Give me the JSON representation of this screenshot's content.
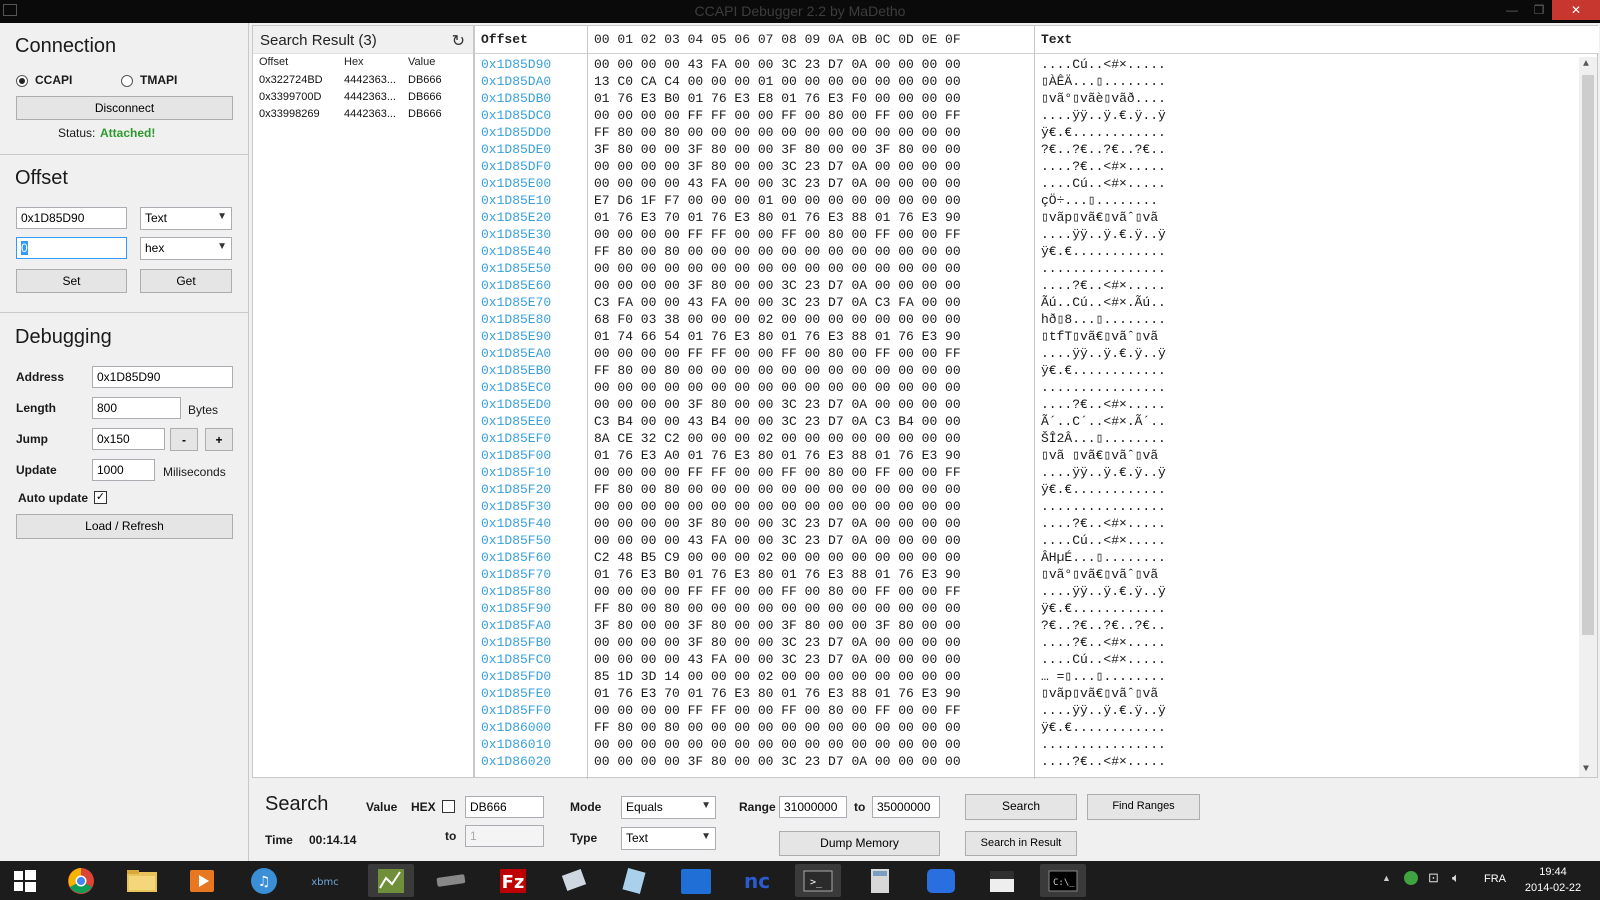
{
  "window": {
    "title": "CCAPI Debugger 2.2 by MaDetho"
  },
  "connection": {
    "title": "Connection",
    "radio_ccapi": "CCAPI",
    "radio_tmapi": "TMAPI",
    "selected": "CCAPI",
    "disconnect_label": "Disconnect",
    "status_label": "Status:",
    "status_value": "Attached!",
    "status_color": "#2e9a2e"
  },
  "offset": {
    "title": "Offset",
    "address_value": "0x1D85D90",
    "type_selected": "Text",
    "value_value": "0",
    "format_selected": "hex",
    "set_label": "Set",
    "get_label": "Get"
  },
  "debugging": {
    "title": "Debugging",
    "address_label": "Address",
    "address_value": "0x1D85D90",
    "length_label": "Length",
    "length_value": "800",
    "length_unit": "Bytes",
    "jump_label": "Jump",
    "jump_value": "0x150",
    "jump_minus": "-",
    "jump_plus": "+",
    "update_label": "Update",
    "update_value": "1000",
    "update_unit": "Miliseconds",
    "auto_update_label": "Auto update",
    "auto_update_checked": "✓",
    "load_label": "Load / Refresh"
  },
  "search_results": {
    "title": "Search Result (3)",
    "columns": [
      "Offset",
      "Hex",
      "Value"
    ],
    "rows": [
      [
        "0x322724BD",
        "4442363...",
        "DB666"
      ],
      [
        "0x3399700D",
        "4442363...",
        "DB666"
      ],
      [
        "0x33998269",
        "4442363...",
        "DB666"
      ]
    ]
  },
  "hex_view": {
    "col_offset": "Offset",
    "col_bytes": "00 01 02 03 04 05 06 07 08 09 0A 0B 0C 0D 0E 0F",
    "col_text": "Text",
    "lines": [
      [
        "0x1D85D90",
        "00 00 00 00 43 FA 00 00 3C 23 D7 0A 00 00 00 00",
        "....Cú..<#×....."
      ],
      [
        "0x1D85DA0",
        "13 C0 CA C4 00 00 00 01 00 00 00 00 00 00 00 00",
        "▯ÀÊÄ...▯........"
      ],
      [
        "0x1D85DB0",
        "01 76 E3 B0 01 76 E3 E8 01 76 E3 F0 00 00 00 00",
        "▯vã°▯vãè▯vãð...."
      ],
      [
        "0x1D85DC0",
        "00 00 00 00 FF FF 00 00 FF 00 80 00 FF 00 00 FF",
        "....ÿÿ..ÿ.€.ÿ..ÿ"
      ],
      [
        "0x1D85DD0",
        "FF 80 00 80 00 00 00 00 00 00 00 00 00 00 00 00",
        "ÿ€.€............"
      ],
      [
        "0x1D85DE0",
        "3F 80 00 00 3F 80 00 00 3F 80 00 00 3F 80 00 00",
        "?€..?€..?€..?€.."
      ],
      [
        "0x1D85DF0",
        "00 00 00 00 3F 80 00 00 3C 23 D7 0A 00 00 00 00",
        "....?€..<#×....."
      ],
      [
        "0x1D85E00",
        "00 00 00 00 43 FA 00 00 3C 23 D7 0A 00 00 00 00",
        "....Cú..<#×....."
      ],
      [
        "0x1D85E10",
        "E7 D6 1F F7 00 00 00 01 00 00 00 00 00 00 00 00",
        "çÖ÷...▯........"
      ],
      [
        "0x1D85E20",
        "01 76 E3 70 01 76 E3 80 01 76 E3 88 01 76 E3 90",
        "▯vãp▯vã€▯vãˆ▯vã"
      ],
      [
        "0x1D85E30",
        "00 00 00 00 FF FF 00 00 FF 00 80 00 FF 00 00 FF",
        "....ÿÿ..ÿ.€.ÿ..ÿ"
      ],
      [
        "0x1D85E40",
        "FF 80 00 80 00 00 00 00 00 00 00 00 00 00 00 00",
        "ÿ€.€............"
      ],
      [
        "0x1D85E50",
        "00 00 00 00 00 00 00 00 00 00 00 00 00 00 00 00",
        "................"
      ],
      [
        "0x1D85E60",
        "00 00 00 00 3F 80 00 00 3C 23 D7 0A 00 00 00 00",
        "....?€..<#×....."
      ],
      [
        "0x1D85E70",
        "C3 FA 00 00 43 FA 00 00 3C 23 D7 0A C3 FA 00 00",
        "Ãú..Cú..<#×.Ãú.."
      ],
      [
        "0x1D85E80",
        "68 F0 03 38 00 00 00 02 00 00 00 00 00 00 00 00",
        "hð▯8...▯........"
      ],
      [
        "0x1D85E90",
        "01 74 66 54 01 76 E3 80 01 76 E3 88 01 76 E3 90",
        "▯tfT▯vã€▯vãˆ▯vã"
      ],
      [
        "0x1D85EA0",
        "00 00 00 00 FF FF 00 00 FF 00 80 00 FF 00 00 FF",
        "....ÿÿ..ÿ.€.ÿ..ÿ"
      ],
      [
        "0x1D85EB0",
        "FF 80 00 80 00 00 00 00 00 00 00 00 00 00 00 00",
        "ÿ€.€............"
      ],
      [
        "0x1D85EC0",
        "00 00 00 00 00 00 00 00 00 00 00 00 00 00 00 00",
        "................"
      ],
      [
        "0x1D85ED0",
        "00 00 00 00 3F 80 00 00 3C 23 D7 0A 00 00 00 00",
        "....?€..<#×....."
      ],
      [
        "0x1D85EE0",
        "C3 B4 00 00 43 B4 00 00 3C 23 D7 0A C3 B4 00 00",
        "Ã´..C´..<#×.Ã´.."
      ],
      [
        "0x1D85EF0",
        "8A CE 32 C2 00 00 00 02 00 00 00 00 00 00 00 00",
        "ŠÎ2Â...▯........"
      ],
      [
        "0x1D85F00",
        "01 76 E3 A0 01 76 E3 80 01 76 E3 88 01 76 E3 90",
        "▯vã ▯vã€▯vãˆ▯vã"
      ],
      [
        "0x1D85F10",
        "00 00 00 00 FF FF 00 00 FF 00 80 00 FF 00 00 FF",
        "....ÿÿ..ÿ.€.ÿ..ÿ"
      ],
      [
        "0x1D85F20",
        "FF 80 00 80 00 00 00 00 00 00 00 00 00 00 00 00",
        "ÿ€.€............"
      ],
      [
        "0x1D85F30",
        "00 00 00 00 00 00 00 00 00 00 00 00 00 00 00 00",
        "................"
      ],
      [
        "0x1D85F40",
        "00 00 00 00 3F 80 00 00 3C 23 D7 0A 00 00 00 00",
        "....?€..<#×....."
      ],
      [
        "0x1D85F50",
        "00 00 00 00 43 FA 00 00 3C 23 D7 0A 00 00 00 00",
        "....Cú..<#×....."
      ],
      [
        "0x1D85F60",
        "C2 48 B5 C9 00 00 00 02 00 00 00 00 00 00 00 00",
        "ÂHµÉ...▯........"
      ],
      [
        "0x1D85F70",
        "01 76 E3 B0 01 76 E3 80 01 76 E3 88 01 76 E3 90",
        "▯vã°▯vã€▯vãˆ▯vã"
      ],
      [
        "0x1D85F80",
        "00 00 00 00 FF FF 00 00 FF 00 80 00 FF 00 00 FF",
        "....ÿÿ..ÿ.€.ÿ..ÿ"
      ],
      [
        "0x1D85F90",
        "FF 80 00 80 00 00 00 00 00 00 00 00 00 00 00 00",
        "ÿ€.€............"
      ],
      [
        "0x1D85FA0",
        "3F 80 00 00 3F 80 00 00 3F 80 00 00 3F 80 00 00",
        "?€..?€..?€..?€.."
      ],
      [
        "0x1D85FB0",
        "00 00 00 00 3F 80 00 00 3C 23 D7 0A 00 00 00 00",
        "....?€..<#×....."
      ],
      [
        "0x1D85FC0",
        "00 00 00 00 43 FA 00 00 3C 23 D7 0A 00 00 00 00",
        "....Cú..<#×....."
      ],
      [
        "0x1D85FD0",
        "85 1D 3D 14 00 00 00 02 00 00 00 00 00 00 00 00",
        "… =▯...▯........"
      ],
      [
        "0x1D85FE0",
        "01 76 E3 70 01 76 E3 80 01 76 E3 88 01 76 E3 90",
        "▯vãp▯vã€▯vãˆ▯vã"
      ],
      [
        "0x1D85FF0",
        "00 00 00 00 FF FF 00 00 FF 00 80 00 FF 00 00 FF",
        "....ÿÿ..ÿ.€.ÿ..ÿ"
      ],
      [
        "0x1D86000",
        "FF 80 00 80 00 00 00 00 00 00 00 00 00 00 00 00",
        "ÿ€.€............"
      ],
      [
        "0x1D86010",
        "00 00 00 00 00 00 00 00 00 00 00 00 00 00 00 00",
        "................"
      ],
      [
        "0x1D86020",
        "00 00 00 00 3F 80 00 00 3C 23 D7 0A 00 00 00 00",
        "....?€..<#×....."
      ]
    ]
  },
  "search": {
    "title": "Search",
    "value_label": "Value",
    "hex_label": "HEX",
    "value_input": "DB666",
    "to_label": "to",
    "to_input": "1",
    "time_label": "Time",
    "time_value": "00:14.14",
    "mode_label": "Mode",
    "mode_selected": "Equals",
    "type_label": "Type",
    "type_selected": "Text",
    "range_label": "Range",
    "range_from": "31000000",
    "range_to_label": "to",
    "range_to": "35000000",
    "search_button": "Search",
    "find_ranges_button": "Find Ranges",
    "dump_button": "Dump Memory",
    "search_in_result_button": "Search in Result"
  },
  "taskbar": {
    "lang": "FRA",
    "time": "19:44",
    "date": "2014-02-22"
  }
}
